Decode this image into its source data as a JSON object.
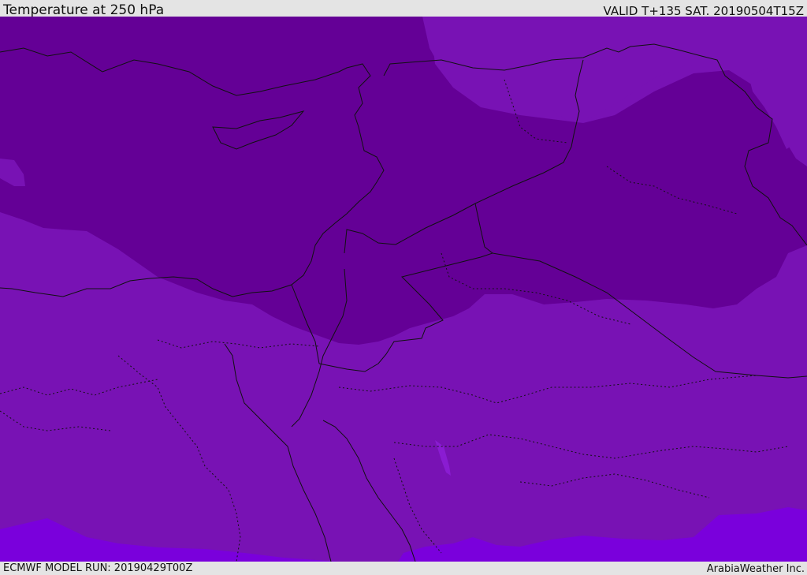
{
  "header": {
    "title": "Temperature at 250 hPa",
    "valid": "VALID T+135 SAT. 20190504T15Z"
  },
  "footer": {
    "model_run": "ECMWF MODEL RUN: 20190429T00Z",
    "credit": "ArabiaWeather Inc."
  },
  "map": {
    "region": "Eastern Mediterranean and Middle East",
    "colors": {
      "coldest": "#640096",
      "cold": "#7812b4",
      "mild": "#7a00dc",
      "lake": "#8a1cd2",
      "border": "#111111"
    }
  }
}
